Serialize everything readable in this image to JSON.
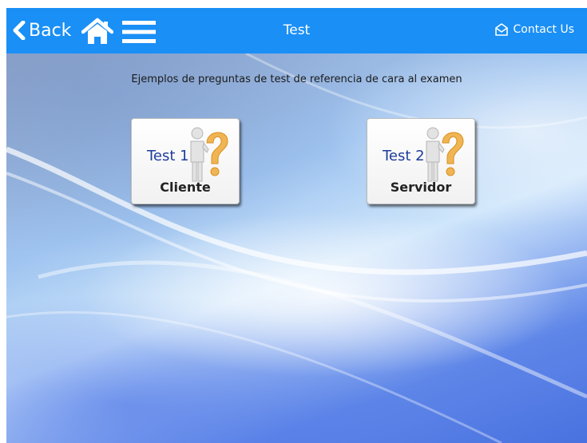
{
  "header": {
    "back_label": "Back",
    "title": "Test",
    "contact_label": "Contact Us",
    "icons": {
      "back": "chevron-left-icon",
      "home": "home-icon",
      "menu": "hamburger-menu-icon",
      "contact": "envelope-icon"
    },
    "bar_color": "#1a8ff5"
  },
  "main": {
    "subtitle": "Ejemplos de preguntas de test de referencia de cara al examen",
    "tiles": [
      {
        "number_label": "Test 1",
        "name_label": "Cliente",
        "icon": "person-question-mark-icon"
      },
      {
        "number_label": "Test 2",
        "name_label": "Servidor",
        "icon": "person-question-mark-icon"
      }
    ]
  }
}
